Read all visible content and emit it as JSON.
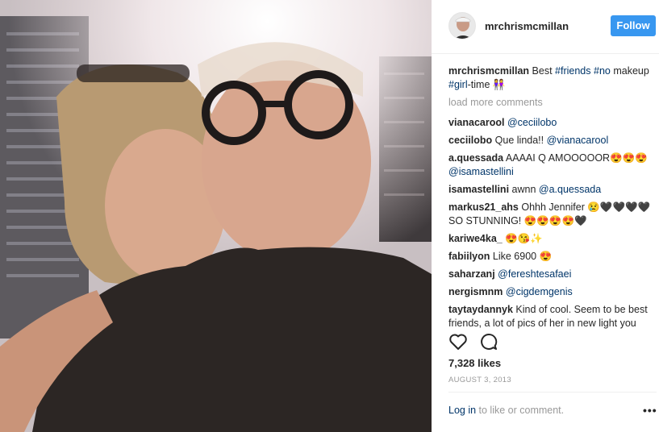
{
  "post": {
    "username": "mrchrismcmillan",
    "follow_label": "Follow",
    "caption_user": "mrchrismcmillan",
    "caption_text_1": "Best ",
    "caption_tag_1": "#friends",
    "caption_text_2": " ",
    "caption_tag_2": "#no",
    "caption_text_3": " makeup ",
    "caption_tag_3": "#girl",
    "caption_text_4": "-time 👭",
    "load_more": "load more comments",
    "likes": "7,328 likes",
    "date": "AUGUST 3, 2013",
    "login_link": "Log in",
    "login_rest": " to like or comment.",
    "more": "•••"
  },
  "comments": [
    {
      "user": "vianacarool",
      "text": "",
      "mention": "@ceciilobo",
      "tail": ""
    },
    {
      "user": "ceciilobo",
      "text": "Que linda!! ",
      "mention": "@vianacarool",
      "tail": ""
    },
    {
      "user": "a.quessada",
      "text": "AAAAI Q AMOOOOOR😍😍😍 ",
      "mention": "@isamastellini",
      "tail": ""
    },
    {
      "user": "isamastellini",
      "text": "awnn ",
      "mention": "@a.quessada",
      "tail": ""
    },
    {
      "user": "markus21_ahs",
      "text": "Ohhh Jennifer 😢🖤🖤🖤🖤 SO STUNNING! 😍😍😍😍🖤",
      "mention": "",
      "tail": ""
    },
    {
      "user": "kariwe4ka_",
      "text": "😍😘✨",
      "mention": "",
      "tail": ""
    },
    {
      "user": "fabiilyon",
      "text": "Like 6900 😍",
      "mention": "",
      "tail": ""
    },
    {
      "user": "saharzanj",
      "text": "",
      "mention": "@fereshtesafaei",
      "tail": ""
    },
    {
      "user": "nergismnm",
      "text": "",
      "mention": "@cigdemgenis",
      "tail": ""
    },
    {
      "user": "taytaydannyk",
      "text": "Kind of cool. Seem to be best friends, a lot of pics of her in new light you",
      "mention": "",
      "tail": ""
    }
  ],
  "icons": {
    "like": "heart-icon",
    "comment": "comment-icon"
  }
}
